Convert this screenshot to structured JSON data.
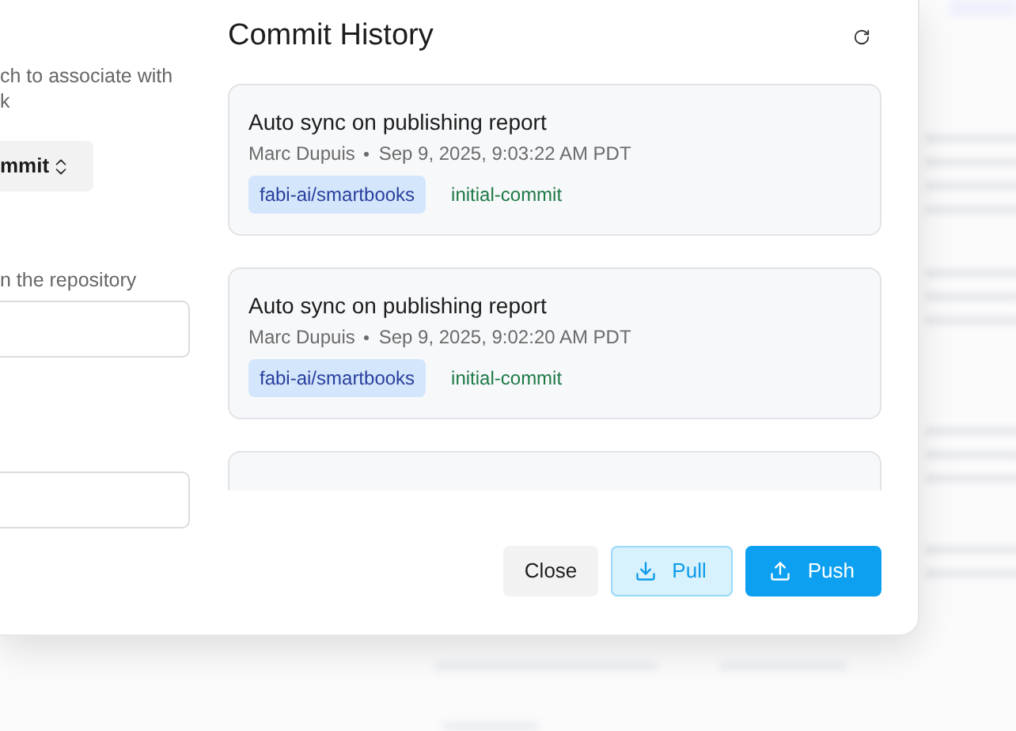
{
  "left_panel": {
    "description_lines": [
      "ch to associate with",
      "k"
    ],
    "branch_select": {
      "value": "mmit"
    },
    "fields": [
      {
        "label": "n the repository"
      }
    ]
  },
  "dialog": {
    "title": "Commit History",
    "commits": [
      {
        "title": "Auto sync on publishing report",
        "author": "Marc Dupuis",
        "time": "Sep 9, 2025, 9:03:22 AM PDT",
        "repo": "fabi-ai/smartbooks",
        "branch": "initial-commit"
      },
      {
        "title": "Auto sync on publishing report",
        "author": "Marc Dupuis",
        "time": "Sep 9, 2025, 9:02:20 AM PDT",
        "repo": "fabi-ai/smartbooks",
        "branch": "initial-commit"
      }
    ],
    "buttons": [
      {
        "kind": "close",
        "label": "Close"
      },
      {
        "kind": "pull",
        "label": "Pull"
      },
      {
        "kind": "push",
        "label": "Push"
      }
    ]
  }
}
